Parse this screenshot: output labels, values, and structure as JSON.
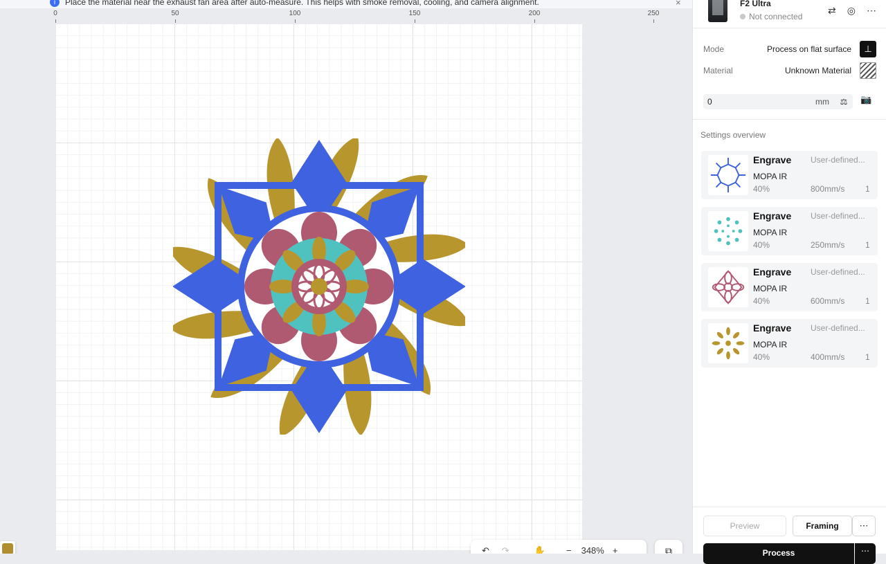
{
  "notice": {
    "text": "Place the material near the exhaust fan area after auto-measure. This helps with smoke removal, cooling, and camera alignment.",
    "close": "×"
  },
  "ruler": {
    "labels": [
      "0",
      "50",
      "100",
      "150",
      "200",
      "250"
    ]
  },
  "toolbar": {
    "undo": "↶",
    "redo": "↷",
    "hand": "✋",
    "zoom_out": "−",
    "zoom": "348%",
    "zoom_in": "+",
    "layers": "⧉"
  },
  "device": {
    "name": "F2 Ultra",
    "status": "Not connected",
    "icons": {
      "switch": "⇄",
      "settings": "◎",
      "more": "⋯"
    }
  },
  "settings": {
    "mode_label": "Mode",
    "mode_value": "Process on flat surface",
    "material_label": "Material",
    "material_value": "Unknown Material",
    "height_value": "0",
    "height_unit": "mm",
    "auto_measure": "⚖",
    "camera": "📷",
    "overview_title": "Settings overview"
  },
  "cards": [
    {
      "title": "Engrave",
      "preset": "User-defined...",
      "laser": "MOPA IR",
      "power": "40%",
      "speed": "800mm/s",
      "pass": "1",
      "color": "#3f63e0"
    },
    {
      "title": "Engrave",
      "preset": "User-defined...",
      "laser": "MOPA IR",
      "power": "40%",
      "speed": "250mm/s",
      "pass": "1",
      "color": "#4fc2c0"
    },
    {
      "title": "Engrave",
      "preset": "User-defined...",
      "laser": "MOPA IR",
      "power": "40%",
      "speed": "600mm/s",
      "pass": "1",
      "color": "#b05a72"
    },
    {
      "title": "Engrave",
      "preset": "User-defined...",
      "laser": "MOPA IR",
      "power": "40%",
      "speed": "400mm/s",
      "pass": "1",
      "color": "#b8962e"
    }
  ],
  "actions": {
    "preview": "Preview",
    "framing": "Framing",
    "more": "⋯",
    "process": "Process",
    "process_more": "⋯"
  },
  "colors": {
    "blue": "#3f63e0",
    "teal": "#4fc2c0",
    "rose": "#b05a72",
    "gold": "#b8962e"
  }
}
